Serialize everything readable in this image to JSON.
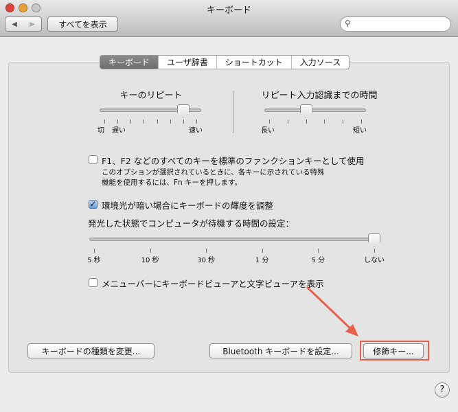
{
  "window": {
    "title": "キーボード"
  },
  "toolbar": {
    "back": "◀",
    "forward": "▶",
    "show_all": "すべてを表示",
    "search_placeholder": ""
  },
  "tabs": [
    "キーボード",
    "ユーザ辞書",
    "ショートカット",
    "入力ソース"
  ],
  "key_repeat": {
    "label": "キーのリピート",
    "min_label": "切",
    "slow_label": "遅い",
    "fast_label": "速い",
    "ticks": 8,
    "value_index": 6
  },
  "delay": {
    "label": "リピート入力認識までの時間",
    "long_label": "長い",
    "short_label": "短い",
    "ticks": 6,
    "value_index": 2
  },
  "fn_option": {
    "label": "F1、F2 などのすべてのキーを標準のファンクションキーとして使用",
    "checked": false,
    "desc1": "このオプションが選択されているときに、各キーに示されている特殊",
    "desc2": "機能を使用するには、Fn キーを押します。"
  },
  "backlight": {
    "label": "環境光が暗い場合にキーボードの輝度を調整",
    "checked": true
  },
  "idle": {
    "label": "発光した状態でコンピュータが待機する時間の設定：",
    "ticks": [
      "5 秒",
      "10 秒",
      "30 秒",
      "1 分",
      "5 分",
      "しない"
    ],
    "value_index": 5
  },
  "viewer_option": {
    "label": "メニューバーにキーボードビューアと文字ビューアを表示",
    "checked": false
  },
  "buttons": {
    "change_type": "キーボードの種類を変更...",
    "bluetooth": "Bluetooth キーボードを設定...",
    "modifier": "修飾キー..."
  },
  "help": "?",
  "colors": {
    "highlight": "#e8604c"
  }
}
